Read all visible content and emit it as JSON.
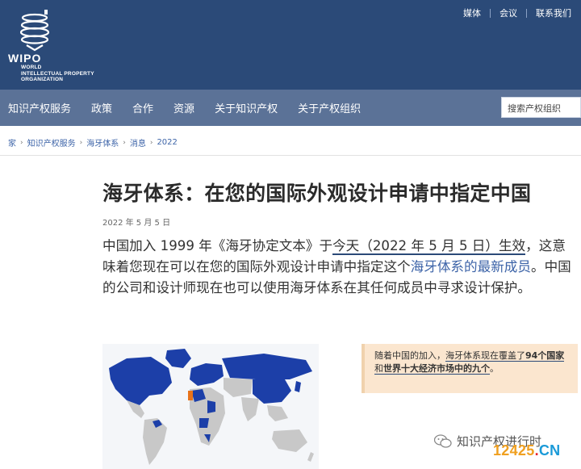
{
  "header": {
    "logo": {
      "wordmark": "WIPO",
      "subtitle_lines": [
        "WORLD",
        "INTELLECTUAL PROPERTY",
        "ORGANIZATION"
      ]
    },
    "top_links": [
      "媒体",
      "会议",
      "联系我们"
    ]
  },
  "nav": {
    "items": [
      "知识产权服务",
      "政策",
      "合作",
      "资源",
      "关于知识产权",
      "关于产权组织"
    ],
    "search_placeholder": "搜索产权组织"
  },
  "breadcrumb": [
    "家",
    "知识产权服务",
    "海牙体系",
    "消息",
    "2022"
  ],
  "article": {
    "title": "海牙体系：在您的国际外观设计申请中指定中国",
    "date": "2022 年 5 月 5 日",
    "lead": {
      "p1": "中国加入 1999 年《海牙协定文本》于",
      "p2": "今天（2022 年 5 月 5 日）生效",
      "p3": "，这意味着您现在可以在您的国际外观设计申请中指定这个",
      "p4": "海牙体系的最新成员",
      "p5": "。中国的公司和设计师现在也可以使用海牙体系在其任何成员中寻求设计保护。"
    },
    "callout": {
      "t1": "随着中国的加入，",
      "t2": "海牙体系现在覆盖了",
      "t3": "94个国家",
      "t4": "和",
      "t5": "世界十大经济市场中的九个",
      "t6": "。"
    }
  },
  "map": {
    "member_color": "#1c3fa8",
    "nonmember_color": "#c8c8c8",
    "highlight_color": "#e8731a"
  },
  "watermark": {
    "wechat_text": "知识产权进行时",
    "site_parts": [
      "12425",
      ".",
      "CN"
    ]
  }
}
